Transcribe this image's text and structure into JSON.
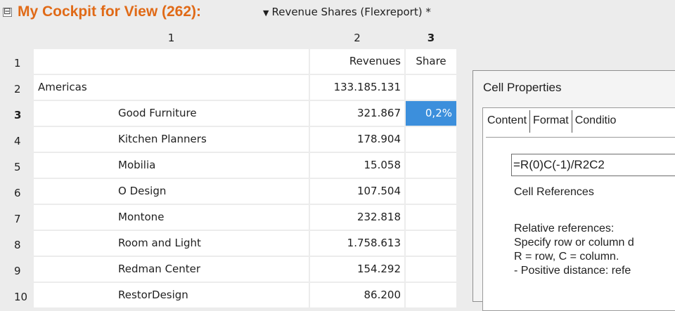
{
  "header": {
    "collapse_glyph": "⊟",
    "title": "My Cockpit for View (262):",
    "view_label": "Revenue Shares (Flexreport) *",
    "accent_color": "#e06a17"
  },
  "grid": {
    "column_headers": [
      "1",
      "2",
      "3"
    ],
    "rows": [
      {
        "num": "1",
        "name": "",
        "value": "Revenues",
        "share": "Share"
      },
      {
        "num": "2",
        "name": "Americas",
        "value": "133.185.131",
        "share": ""
      },
      {
        "num": "3",
        "name": "Good Furniture",
        "value": "321.867",
        "share": "0,2%"
      },
      {
        "num": "4",
        "name": "Kitchen Planners",
        "value": "178.904",
        "share": ""
      },
      {
        "num": "5",
        "name": "Mobilia",
        "value": "15.058",
        "share": ""
      },
      {
        "num": "6",
        "name": "O Design",
        "value": "107.504",
        "share": ""
      },
      {
        "num": "7",
        "name": "Montone",
        "value": "232.818",
        "share": ""
      },
      {
        "num": "8",
        "name": "Room and Light",
        "value": "1.758.613",
        "share": ""
      },
      {
        "num": "9",
        "name": "Redman Center",
        "value": "154.292",
        "share": ""
      },
      {
        "num": "10",
        "name": "RestorDesign",
        "value": "86.200",
        "share": ""
      }
    ],
    "selected_color": "#3c8fdc"
  },
  "dialog": {
    "title": "Cell Properties",
    "tabs": [
      "Content",
      "Format",
      "Conditio"
    ],
    "formula": "=R(0)C(-1)/R2C2",
    "section_label": "Cell References",
    "help_lines": [
      "Relative references:",
      "Specify row or column d",
      "R = row, C = column.",
      "- Positive distance: refe"
    ]
  }
}
